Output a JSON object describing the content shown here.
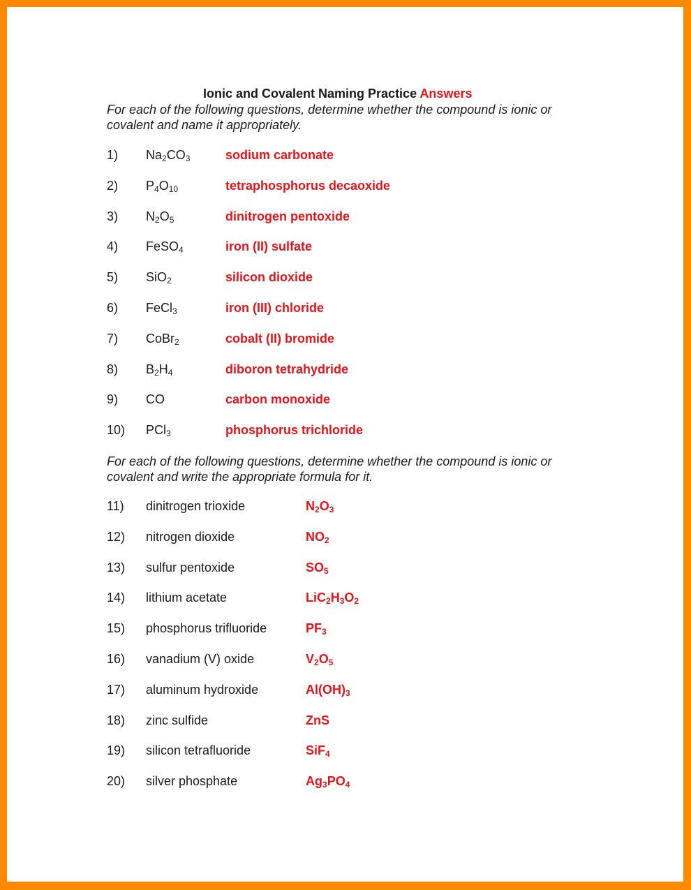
{
  "title": {
    "main": "Ionic and Covalent Naming Practice",
    "accent": "Answers"
  },
  "colors": {
    "border": "#ff8a00",
    "answer": "#e8141b",
    "text": "#1a1a1a"
  },
  "section1": {
    "instructions": "For each of the following questions, determine whether the compound is ionic or covalent and name it appropriately.",
    "items": [
      {
        "num": "1)",
        "formula": [
          [
            "Na",
            ""
          ],
          [
            "2",
            "sub"
          ],
          [
            "CO",
            ""
          ],
          [
            "3",
            "sub"
          ]
        ],
        "answer": "sodium carbonate"
      },
      {
        "num": "2)",
        "formula": [
          [
            "P",
            ""
          ],
          [
            "4",
            "sub"
          ],
          [
            "O",
            ""
          ],
          [
            "10",
            "sub"
          ]
        ],
        "answer": "tetraphosphorus decaoxide"
      },
      {
        "num": "3)",
        "formula": [
          [
            "N",
            ""
          ],
          [
            "2",
            "sub"
          ],
          [
            "O",
            ""
          ],
          [
            "5",
            "sub"
          ]
        ],
        "answer": "dinitrogen pentoxide"
      },
      {
        "num": "4)",
        "formula": [
          [
            "FeSO",
            ""
          ],
          [
            "4",
            "sub"
          ]
        ],
        "answer": "iron (II) sulfate"
      },
      {
        "num": "5)",
        "formula": [
          [
            "SiO",
            ""
          ],
          [
            "2",
            "sub"
          ]
        ],
        "answer": "silicon dioxide"
      },
      {
        "num": "6)",
        "formula": [
          [
            "FeCl",
            ""
          ],
          [
            "3",
            "sub"
          ]
        ],
        "answer": "iron (III) chloride"
      },
      {
        "num": "7)",
        "formula": [
          [
            "CoBr",
            ""
          ],
          [
            "2",
            "sub"
          ]
        ],
        "answer": "cobalt (II) bromide"
      },
      {
        "num": "8)",
        "formula": [
          [
            "B",
            ""
          ],
          [
            "2",
            "sub"
          ],
          [
            "H",
            ""
          ],
          [
            "4",
            "sub"
          ]
        ],
        "answer": "diboron tetrahydride"
      },
      {
        "num": "9)",
        "formula": [
          [
            "CO",
            ""
          ]
        ],
        "answer": "carbon monoxide"
      },
      {
        "num": "10)",
        "formula": [
          [
            "PCl",
            ""
          ],
          [
            "3",
            "sub"
          ]
        ],
        "answer": "phosphorus trichloride"
      }
    ]
  },
  "section2": {
    "instructions": "For each of the following questions, determine whether the compound is ionic or covalent and write the appropriate formula for it.",
    "items": [
      {
        "num": "11)",
        "name": "dinitrogen trioxide",
        "answer": [
          [
            "N",
            ""
          ],
          [
            "2",
            "sub"
          ],
          [
            "O",
            ""
          ],
          [
            "3",
            "sub"
          ]
        ]
      },
      {
        "num": "12)",
        "name": "nitrogen dioxide",
        "answer": [
          [
            "NO",
            ""
          ],
          [
            "2",
            "sub"
          ]
        ]
      },
      {
        "num": "13)",
        "name": "sulfur pentoxide",
        "answer": [
          [
            "SO",
            ""
          ],
          [
            "5",
            "sub"
          ]
        ]
      },
      {
        "num": "14)",
        "name": "lithium acetate",
        "answer": [
          [
            "LiC",
            ""
          ],
          [
            "2",
            "sub"
          ],
          [
            "H",
            ""
          ],
          [
            "3",
            "sub"
          ],
          [
            "O",
            ""
          ],
          [
            "2",
            "sub"
          ]
        ]
      },
      {
        "num": "15)",
        "name": "phosphorus trifluoride",
        "answer": [
          [
            "PF",
            ""
          ],
          [
            "3",
            "sub"
          ]
        ]
      },
      {
        "num": "16)",
        "name": "vanadium (V) oxide",
        "answer": [
          [
            "V",
            ""
          ],
          [
            "2",
            "sub"
          ],
          [
            "O",
            ""
          ],
          [
            "5",
            "sub"
          ]
        ]
      },
      {
        "num": "17)",
        "name": "aluminum hydroxide",
        "answer": [
          [
            "Al(OH)",
            ""
          ],
          [
            "3",
            "sub"
          ]
        ]
      },
      {
        "num": "18)",
        "name": "zinc sulfide",
        "answer": [
          [
            "ZnS",
            ""
          ]
        ]
      },
      {
        "num": "19)",
        "name": "silicon tetrafluoride",
        "answer": [
          [
            "SiF",
            ""
          ],
          [
            "4",
            "sub"
          ]
        ]
      },
      {
        "num": "20)",
        "name": "silver phosphate",
        "answer": [
          [
            "Ag",
            ""
          ],
          [
            "3",
            "sub"
          ],
          [
            "PO",
            ""
          ],
          [
            "4",
            "sub"
          ]
        ]
      }
    ]
  }
}
